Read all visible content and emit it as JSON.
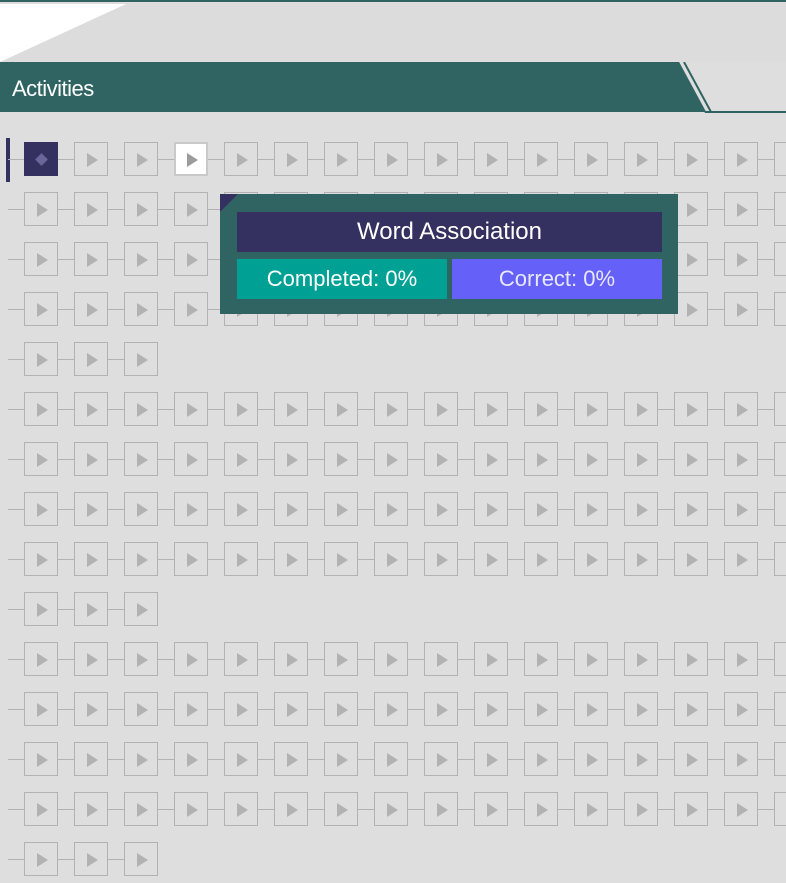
{
  "header": {
    "title": "Activities"
  },
  "tooltip": {
    "title": "Word Association",
    "completed": "Completed: 0%",
    "correct": "Correct: 0%"
  },
  "grid": {
    "groups": [
      {
        "rows": [
          16,
          16,
          16,
          16,
          3
        ]
      },
      {
        "rows": [
          16,
          16,
          16,
          16,
          3
        ]
      },
      {
        "rows": [
          16,
          16,
          16,
          16,
          3
        ]
      }
    ],
    "current_tile": "1",
    "highlighted_tile": "4",
    "tile_state": "not started"
  },
  "colors": {
    "teal": "#2f6462",
    "navy": "#34305f",
    "completed": "#00a195",
    "correct": "#6460f8",
    "tile_border": "#b2b2b2",
    "background": "#dedede"
  },
  "icons": {
    "tile": "play-icon",
    "current": "diamond-icon"
  }
}
